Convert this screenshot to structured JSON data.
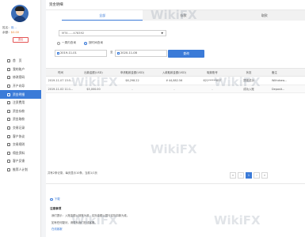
{
  "sidebar": {
    "name_label": "姓名：",
    "name_value": "岗...",
    "balance_label": "余额：",
    "balance_value": "$0.00",
    "logout_label": "退出",
    "items": [
      {
        "label": "首　页"
      },
      {
        "label": "我的账户"
      },
      {
        "label": "修改密码"
      },
      {
        "label": "开户向导"
      },
      {
        "label": "资金明细"
      },
      {
        "label": "注资费用"
      },
      {
        "label": "资金存款"
      },
      {
        "label": "资金取款"
      },
      {
        "label": "交易记录"
      },
      {
        "label": "客户协议"
      },
      {
        "label": "交易规则"
      },
      {
        "label": "佣金资料"
      },
      {
        "label": "客户反馈"
      },
      {
        "label": "推荐人计划"
      }
    ],
    "active_index": 4
  },
  "panel": {
    "title": "资金明细",
    "tabs": [
      {
        "label": "全部"
      },
      {
        "label": "存款"
      },
      {
        "label": "取款"
      }
    ]
  },
  "filter": {
    "account_label": "交易账号",
    "account_value": "MT4......478392",
    "radio_recent": "一周内查询",
    "radio_range": "按时间查询",
    "date_from": "2019-11-01",
    "date_sep": "至",
    "date_to": "2020-11-08",
    "query_label": "查询"
  },
  "table": {
    "headers": [
      "时间",
      "出款金额(USD)",
      "申请取款金额(USD)",
      "入款取款金额(USD)",
      "取款账号",
      "状态",
      "备注"
    ],
    "rows": [
      [
        "2019-11-07 15:5...",
        "-",
        "$6,298.22",
        "¥ 44,882.56",
        "621******857",
        "提现成功",
        "Withdraw..."
      ],
      [
        "2019-11-02 11:1...",
        "$5,000.00",
        "-",
        "-",
        "-",
        "成功入账",
        "Deposit..."
      ]
    ]
  },
  "pagination": {
    "info": "共有2条记录，每页显示10条，当前1/1页",
    "pages": [
      "«",
      "‹",
      "1",
      "›",
      "»"
    ],
    "active": "1"
  },
  "notes": {
    "download_label": "下载",
    "title": "注意事项",
    "items": [
      "我们提示：入账金额以到账为准，实际金额以银行实际扣款为准。",
      "如有任何疑问，请联系我们在线客服。"
    ],
    "link_text": "在线客服"
  },
  "watermark": "WikiFX",
  "colors": {
    "accent": "#3b7bd8",
    "logout": "#e45454",
    "balance": "#e8822b"
  }
}
